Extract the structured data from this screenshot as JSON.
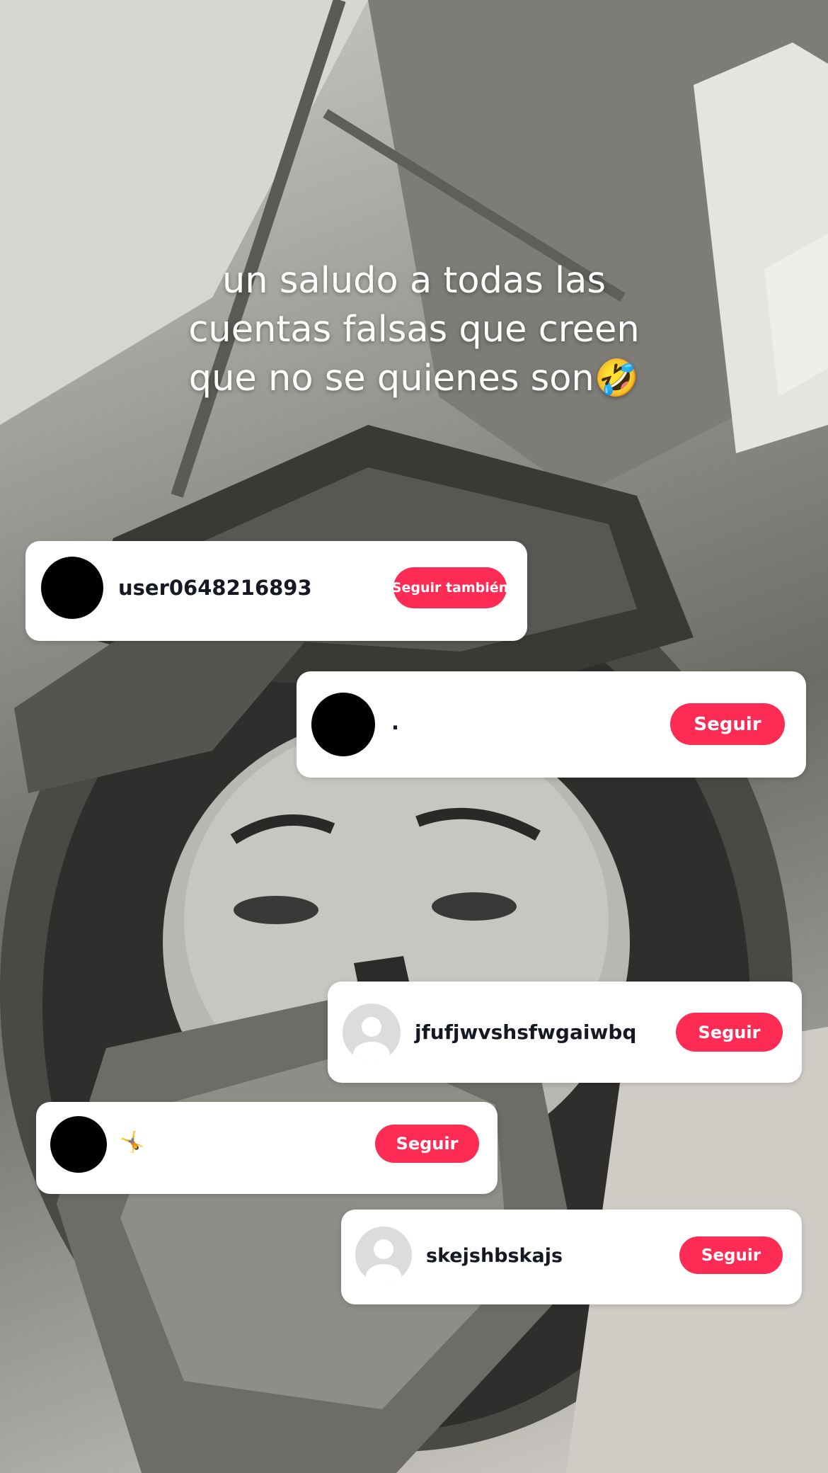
{
  "caption": {
    "line1": "un saludo a todas las",
    "line2": "cuentas falsas que creen",
    "line3": "que no se quienes son🤣"
  },
  "cards": [
    {
      "username": "user0648216893",
      "button": "Seguir también",
      "avatar": "black"
    },
    {
      "username": ".",
      "button": "Seguir",
      "avatar": "black"
    },
    {
      "username": "jfufjwvshsfwgaiwbq",
      "button": "Seguir",
      "avatar": "default-person-icon"
    },
    {
      "username": "🤸",
      "button": "Seguir",
      "avatar": "black"
    },
    {
      "username": "skejshbskajs",
      "button": "Seguir",
      "avatar": "default-person-icon"
    }
  ],
  "colors": {
    "follow_button": "#fe2c55",
    "card": "#ffffff",
    "text": "#161823"
  }
}
